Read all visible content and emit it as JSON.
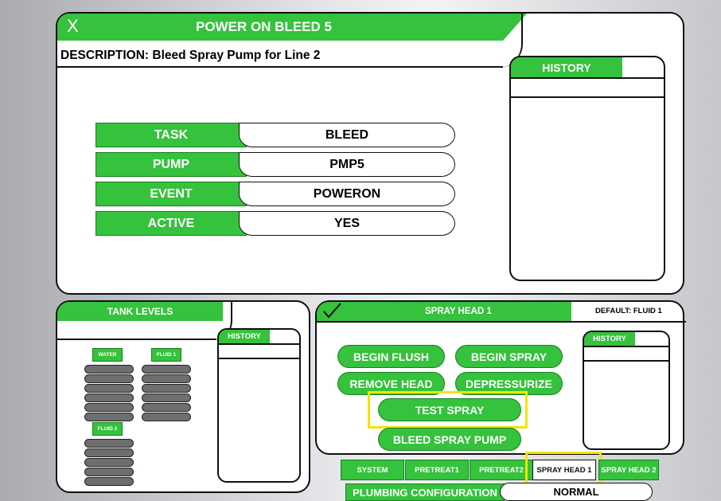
{
  "main": {
    "close_glyph": "X",
    "title": "POWER ON BLEED 5",
    "description": "DESCRIPTION: Bleed Spray Pump for Line 2",
    "history_title": "HISTORY",
    "rows": [
      {
        "label": "TASK",
        "value": "BLEED"
      },
      {
        "label": "PUMP",
        "value": "PMP5"
      },
      {
        "label": "EVENT",
        "value": "POWERON"
      },
      {
        "label": "ACTIVE",
        "value": "YES"
      }
    ]
  },
  "tank_levels": {
    "title": "TANK LEVELS",
    "history_title": "HISTORY",
    "tanks": [
      "WATER",
      "FLUID 1",
      "FLUID 2"
    ]
  },
  "spray_head": {
    "check_icon": "check-icon",
    "title": "SPRAY HEAD 1",
    "default_label": "DEFAULT: FLUID 1",
    "history_title": "HISTORY",
    "buttons": {
      "begin_flush": "BEGIN FLUSH",
      "begin_spray": "BEGIN SPRAY",
      "remove_head": "REMOVE HEAD",
      "depressurize": "DEPRESSURIZE",
      "test_spray": "TEST SPRAY",
      "bleed_spray_pump": "BLEED SPRAY PUMP"
    }
  },
  "tabs": [
    "SYSTEM",
    "PRETREAT1",
    "PRETREAT2",
    "SPRAY HEAD 1",
    "SPRAY HEAD 2"
  ],
  "plumbing": {
    "label": "PLUMBING CONFIGURATION",
    "value": "NORMAL"
  },
  "colors": {
    "accent": "#35c23c",
    "highlight": "#f2e600",
    "outline": "#111111"
  }
}
